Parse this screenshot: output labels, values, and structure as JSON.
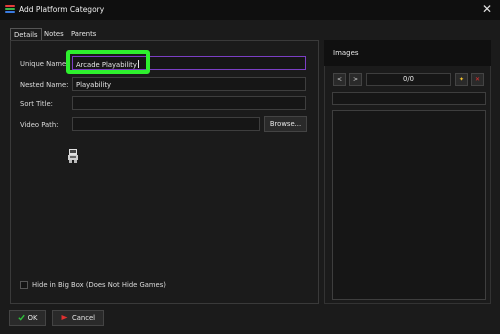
{
  "window": {
    "title": "Add Platform Category",
    "close_glyph": "✕",
    "icon_colors": [
      "#e63b3b",
      "#3bb54a",
      "#3a7be0"
    ]
  },
  "tabs": [
    {
      "label": "Details",
      "active": true
    },
    {
      "label": "Notes",
      "active": false
    },
    {
      "label": "Parents",
      "active": false
    }
  ],
  "details": {
    "unique_name": {
      "label": "Unique Name:",
      "value": "Arcade Playability"
    },
    "nested_name": {
      "label": "Nested Name:",
      "value": "Playability"
    },
    "sort_title": {
      "label": "Sort Title:",
      "value": ""
    },
    "video_path": {
      "label": "Video Path:",
      "value": ""
    },
    "browse_label": "Browse...",
    "hide_in_bigbox": {
      "label": "Hide in Big Box (Does Not Hide Games)",
      "checked": false
    }
  },
  "images": {
    "title": "Images",
    "prev_glyph": "<",
    "next_glyph": ">",
    "counter": "0/0",
    "add_glyph": "✦",
    "remove_glyph": "✕"
  },
  "footer": {
    "ok_label": "OK",
    "cancel_label": "Cancel",
    "ok_icon_color": "#2fbf3a",
    "cancel_icon_color": "#e0302f"
  },
  "colors": {
    "accent_focus": "#7b3fc4",
    "highlight": "#2ef02e"
  }
}
